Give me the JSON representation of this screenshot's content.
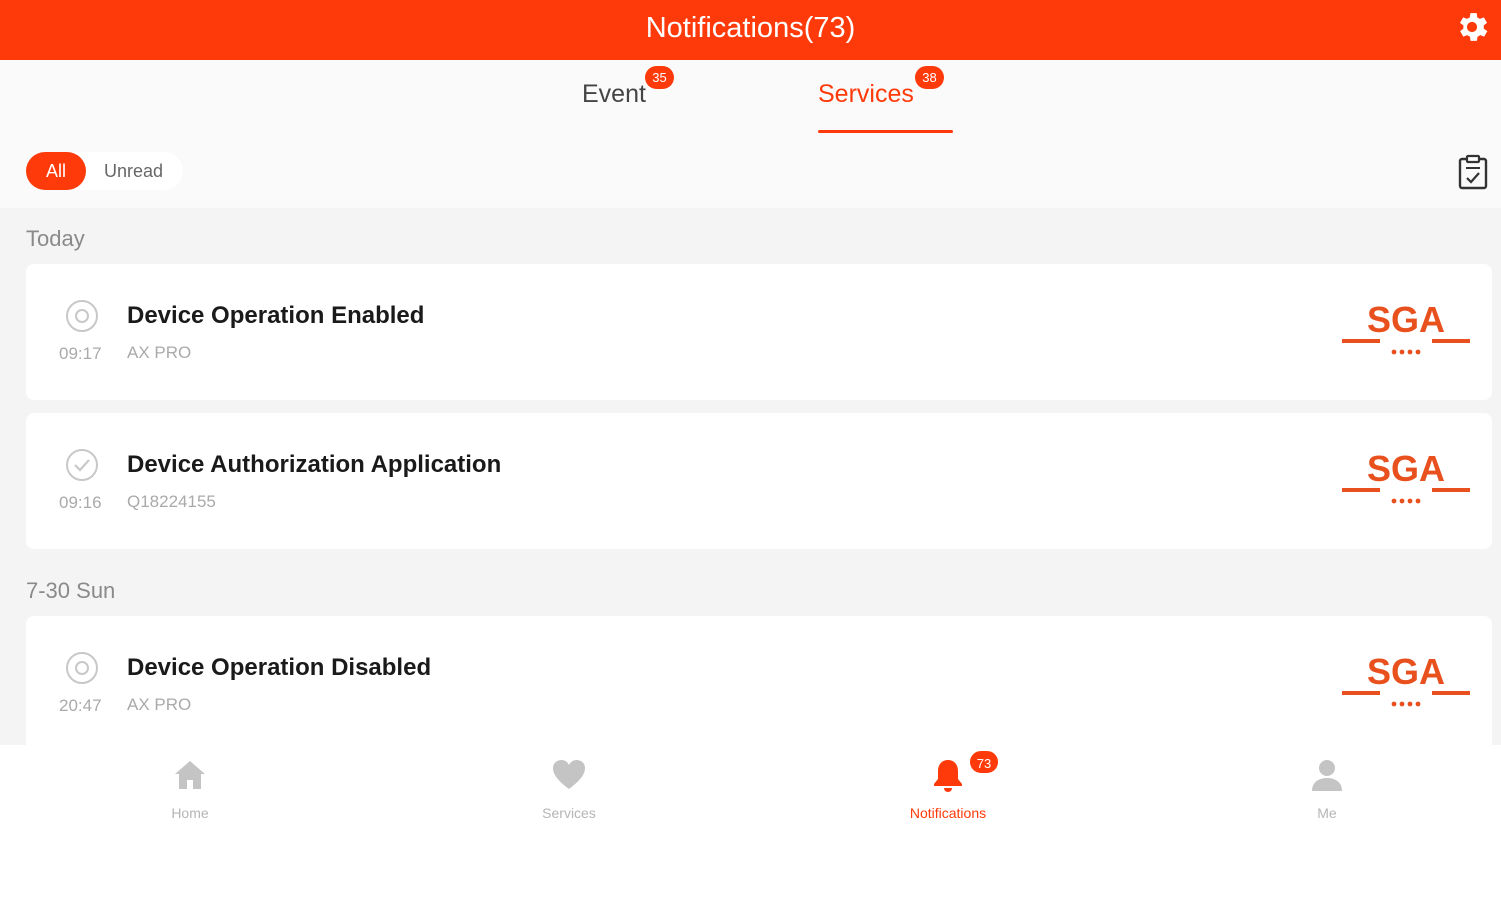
{
  "header": {
    "title": "Notifications(73)",
    "settings_icon": "gear-icon"
  },
  "tabs": [
    {
      "label": "Event",
      "badge": "35",
      "active": false
    },
    {
      "label": "Services",
      "badge": "38",
      "active": true
    }
  ],
  "filters": {
    "all_label": "All",
    "unread_label": "Unread",
    "selected": "All",
    "action_icon": "clipboard-check-icon"
  },
  "sections": [
    {
      "date": "Today",
      "items": [
        {
          "title": "Device Operation Enabled",
          "time": "09:17",
          "subtitle": "AX PRO",
          "icon": "circle-dot-icon",
          "logo": "SGA"
        },
        {
          "title": "Device Authorization Application",
          "time": "09:16",
          "subtitle": "Q18224155",
          "icon": "check-circle-icon",
          "logo": "SGA"
        }
      ]
    },
    {
      "date": "7-30 Sun",
      "items": [
        {
          "title": "Device Operation Disabled",
          "time": "20:47",
          "subtitle": "AX PRO",
          "icon": "circle-dot-icon",
          "logo": "SGA"
        }
      ]
    }
  ],
  "bottom_nav": [
    {
      "label": "Home",
      "icon": "home-icon",
      "active": false
    },
    {
      "label": "Services",
      "icon": "heart-icon",
      "active": false
    },
    {
      "label": "Notifications",
      "icon": "bell-icon",
      "active": true,
      "badge": "73"
    },
    {
      "label": "Me",
      "icon": "user-icon",
      "active": false
    }
  ],
  "colors": {
    "accent": "#ff3a0a",
    "background": "#f4f4f4",
    "muted_text": "#aaaaaa"
  }
}
